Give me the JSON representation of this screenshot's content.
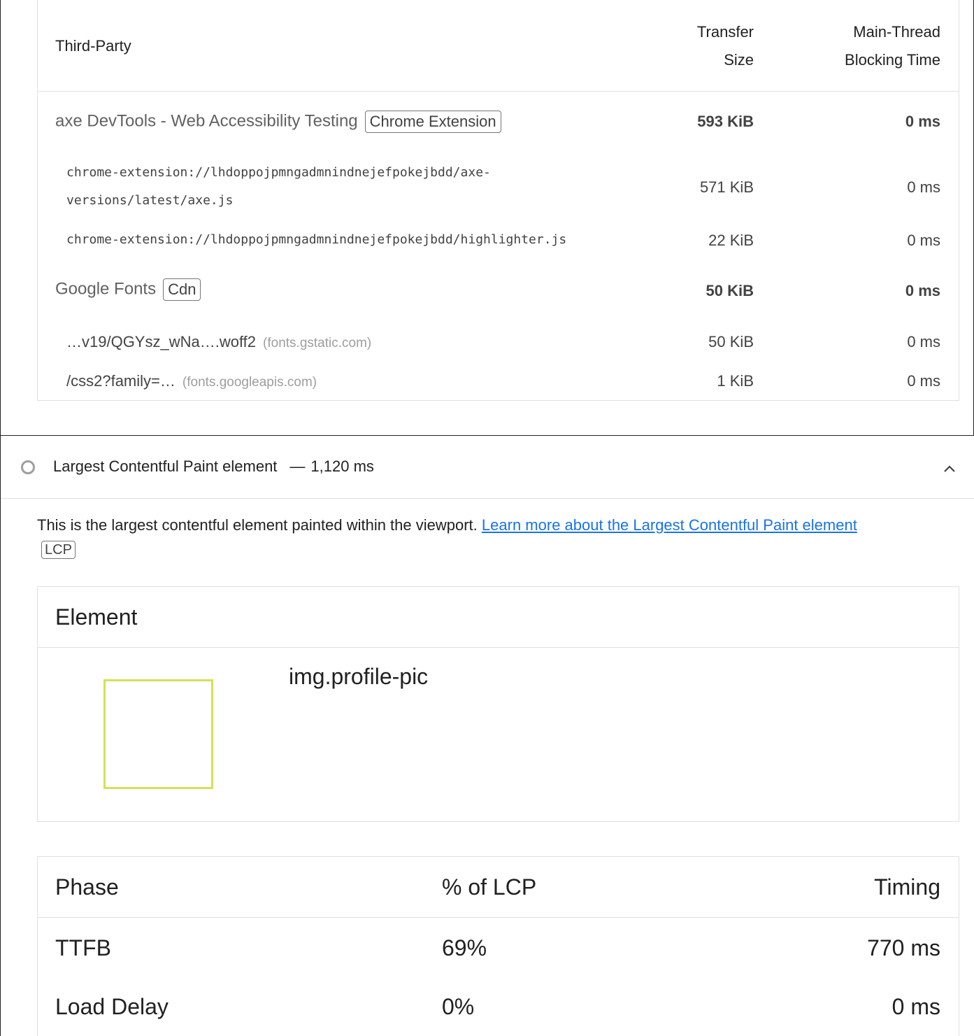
{
  "third_party": {
    "headers": {
      "party": "Third-Party",
      "size_line1": "Transfer",
      "size_line2": "Size",
      "blocking_line1": "Main-Thread",
      "blocking_line2": "Blocking Time"
    },
    "entities": [
      {
        "name": "axe DevTools - Web Accessibility Testing",
        "badge": "Chrome Extension",
        "size": "593 KiB",
        "time": "0 ms",
        "items": [
          {
            "line1": "chrome-extension://lhdoppojpmngadmnindnejefpokejbdd/axe-",
            "line2": "versions/latest/axe.js",
            "size": "571 KiB",
            "time": "0 ms"
          },
          {
            "line1": "chrome-extension://lhdoppojpmngadmnindnejefpokejbdd/highlighter.js",
            "size": "22 KiB",
            "time": "0 ms"
          }
        ]
      },
      {
        "name": "Google Fonts",
        "badge": "Cdn",
        "size": "50 KiB",
        "time": "0 ms",
        "items": [
          {
            "path": "…v19/QGYsz_wNa….woff2",
            "host": "(fonts.gstatic.com)",
            "size": "50 KiB",
            "time": "0 ms"
          },
          {
            "path": "/css2?family=…",
            "host": "(fonts.googleapis.com)",
            "size": "1 KiB",
            "time": "0 ms"
          }
        ]
      }
    ]
  },
  "lcp_audit": {
    "icon": "circle-outline-icon",
    "title": "Largest Contentful Paint element",
    "separator": "—",
    "value": "1,120 ms",
    "chevron": "chevron-up-icon",
    "description": "This is the largest contentful element painted within the viewport.",
    "learn_more": "Learn more about the Largest Contentful Paint element",
    "badge": "LCP"
  },
  "element_table": {
    "header": "Element",
    "selector": "img.profile-pic",
    "thumbnail_color": "#d4e157"
  },
  "phase_table": {
    "headers": [
      "Phase",
      "% of LCP",
      "Timing"
    ],
    "rows": [
      {
        "phase": "TTFB",
        "percent": "69%",
        "timing": "770 ms"
      },
      {
        "phase": "Load Delay",
        "percent": "0%",
        "timing": "0 ms"
      }
    ]
  }
}
